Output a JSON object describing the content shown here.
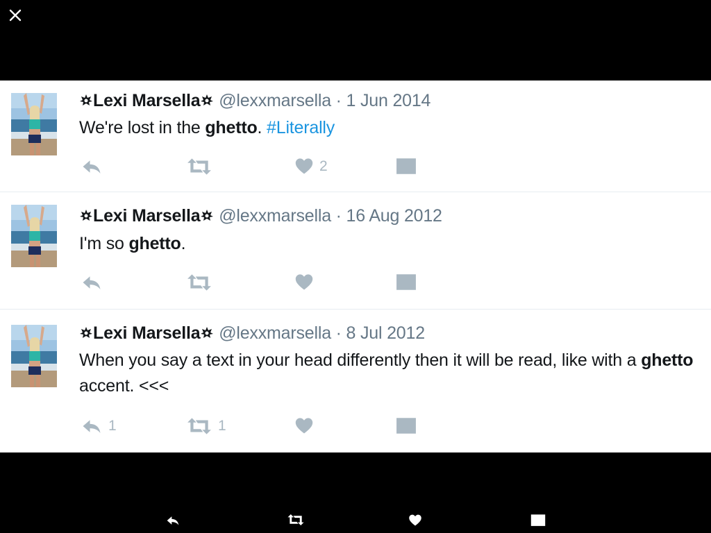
{
  "colors": {
    "background": "#000000",
    "card": "#ffffff",
    "name": "#14171a",
    "meta": "#657786",
    "hashtag": "#1b95e0",
    "action_icon": "#aab8c2"
  },
  "viewer": {
    "close_icon": "close-icon"
  },
  "tweets": [
    {
      "name": "Lexi Marsella",
      "handle": "@lexxmarsella",
      "separator": "·",
      "date": "1 Jun 2014",
      "text": {
        "a": "We're lost in the ",
        "b": "ghetto",
        "c": ". ",
        "hashtag": "#Literally"
      },
      "replies": "",
      "retweets": "",
      "likes": "2"
    },
    {
      "name": "Lexi Marsella",
      "handle": "@lexxmarsella",
      "separator": "·",
      "date": "16 Aug 2012",
      "text": {
        "a": "I'm so ",
        "b": "ghetto",
        "c": "."
      },
      "replies": "",
      "retweets": "",
      "likes": ""
    },
    {
      "name": "Lexi Marsella",
      "handle": "@lexxmarsella",
      "separator": "·",
      "date": "8 Jul 2012",
      "text": {
        "a": "When you say a text in your head differently then it will be read, like with a ",
        "b": "ghetto",
        "c": " accent. <<<"
      },
      "replies": "1",
      "retweets": "1",
      "likes": ""
    }
  ],
  "bottom_bar": {
    "icons": [
      "reply-icon",
      "retweet-icon",
      "like-icon",
      "message-icon"
    ]
  }
}
